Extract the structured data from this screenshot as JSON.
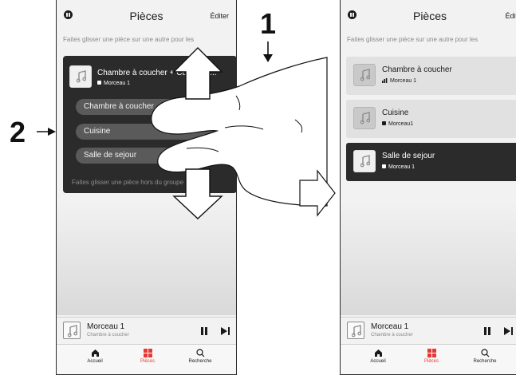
{
  "left": {
    "header": {
      "title": "Pièces",
      "edit_label": "Éditer"
    },
    "hint": "Faites glisser une pièce sur une autre pour les",
    "group": {
      "title": "Chambre à coucher + Cuisine +...",
      "track": "Morceau 1",
      "rooms": [
        "Chambre à coucher",
        "Cuisine",
        "Salle de sejour"
      ],
      "hint": "Faites glisser une pièce hors du groupe pour"
    },
    "player": {
      "track": "Morceau 1",
      "room": "Chambre à coucher"
    },
    "tabs": [
      "Accueil",
      "Pièces",
      "Recherche"
    ]
  },
  "right": {
    "header": {
      "title": "Pièces",
      "edit_label": "Éditer"
    },
    "hint": "Faites glisser une pièce sur une autre pour les",
    "rooms": [
      {
        "name": "Chambre à coucher",
        "track": "Morceau 1",
        "status_icon": "equalizer-icon"
      },
      {
        "name": "Cuisine",
        "track": "Morceau1",
        "status_icon": "square-icon"
      },
      {
        "name": "Salle de sejour",
        "track": "Morceau 1",
        "status_icon": "square-icon"
      }
    ],
    "player": {
      "track": "Morceau 1",
      "room": "Chambre à coucher"
    },
    "tabs": [
      "Accueil",
      "Pièces",
      "Recherche"
    ]
  },
  "callouts": {
    "step1": "1",
    "step2": "2"
  },
  "colors": {
    "accent": "#e53935",
    "dark_card": "#2b2b2b",
    "pill": "#5a5a5a"
  }
}
